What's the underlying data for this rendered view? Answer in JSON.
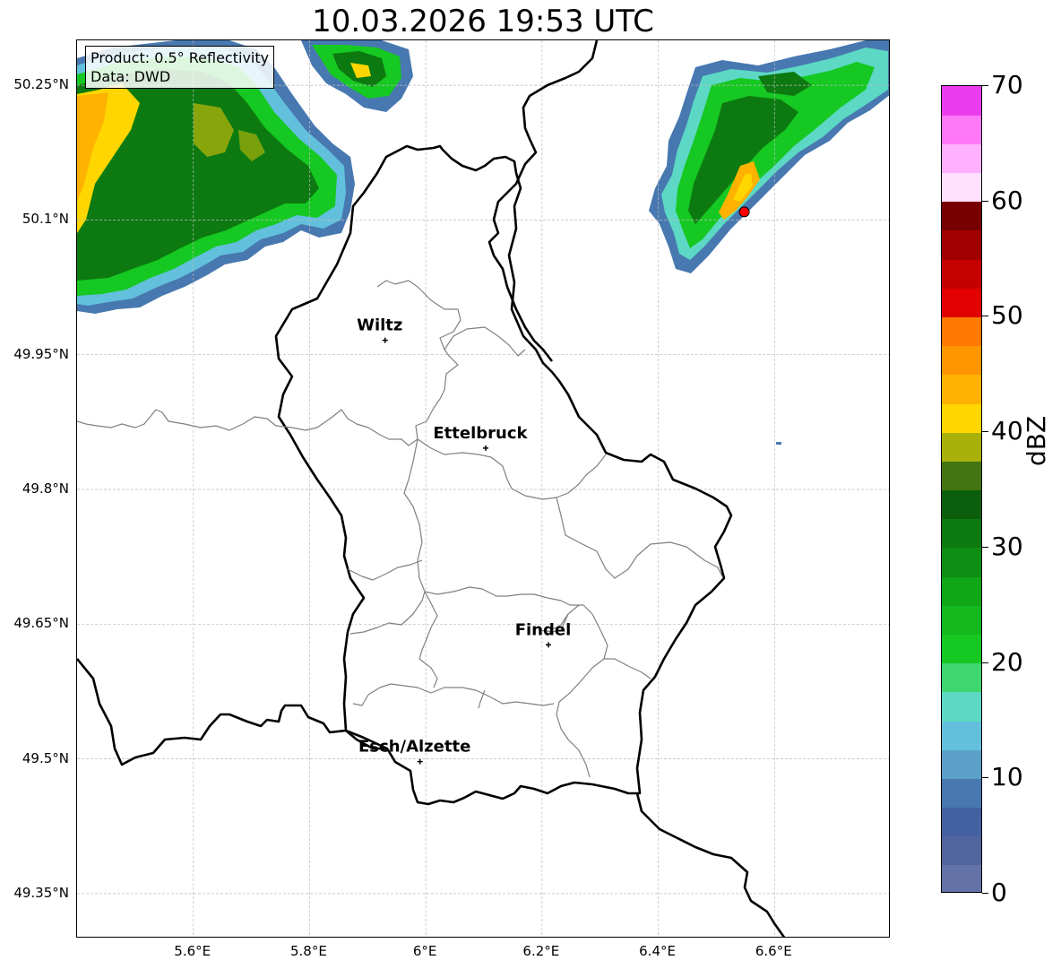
{
  "title": "10.03.2026 19:53 UTC",
  "info": {
    "product": "Product: 0.5° Reflectivity",
    "data": "Data: DWD"
  },
  "lat_labels": [
    "50.25°N",
    "50.1°N",
    "49.95°N",
    "49.8°N",
    "49.65°N",
    "49.5°N",
    "49.35°N"
  ],
  "lon_labels": [
    "5.6°E",
    "5.8°E",
    "6°E",
    "6.2°E",
    "6.4°E",
    "6.6°E"
  ],
  "cities": [
    {
      "name": "Wiltz",
      "lon": 5.93,
      "lat": 49.966
    },
    {
      "name": "Ettelbruck",
      "lon": 6.103,
      "lat": 49.846
    },
    {
      "name": "Findel",
      "lon": 6.211,
      "lat": 49.627
    },
    {
      "name": "Esch/Alzette",
      "lon": 5.99,
      "lat": 49.497
    }
  ],
  "radar_site": {
    "lon": 6.548,
    "lat": 50.109,
    "color": "#ff0000"
  },
  "colorbar": {
    "unit": "dBZ",
    "min": 0,
    "max": 70,
    "tick_labels": [
      "0",
      "10",
      "20",
      "30",
      "40",
      "50",
      "60",
      "70"
    ],
    "colors": [
      "#6373a8",
      "#50659d",
      "#4360a1",
      "#4878b0",
      "#5aa0c8",
      "#62c0dc",
      "#5cd8c4",
      "#3ed66e",
      "#16c822",
      "#12b81c",
      "#10a616",
      "#0d8e12",
      "#0c7a10",
      "#0a5e0c",
      "#447512",
      "#a8b00a",
      "#ffd600",
      "#ffb200",
      "#ff9600",
      "#ff7a00",
      "#e20000",
      "#c40000",
      "#a00000",
      "#780000",
      "#ffe0ff",
      "#ffb0ff",
      "#ff78f8",
      "#ea3cee"
    ]
  },
  "map_extent": {
    "lon_min": 5.4,
    "lon_max": 6.8,
    "lat_min": 49.3,
    "lat_max": 50.3
  },
  "colors": {
    "border": "#000000",
    "district": "#808080",
    "grid": "#bbbbbb"
  }
}
